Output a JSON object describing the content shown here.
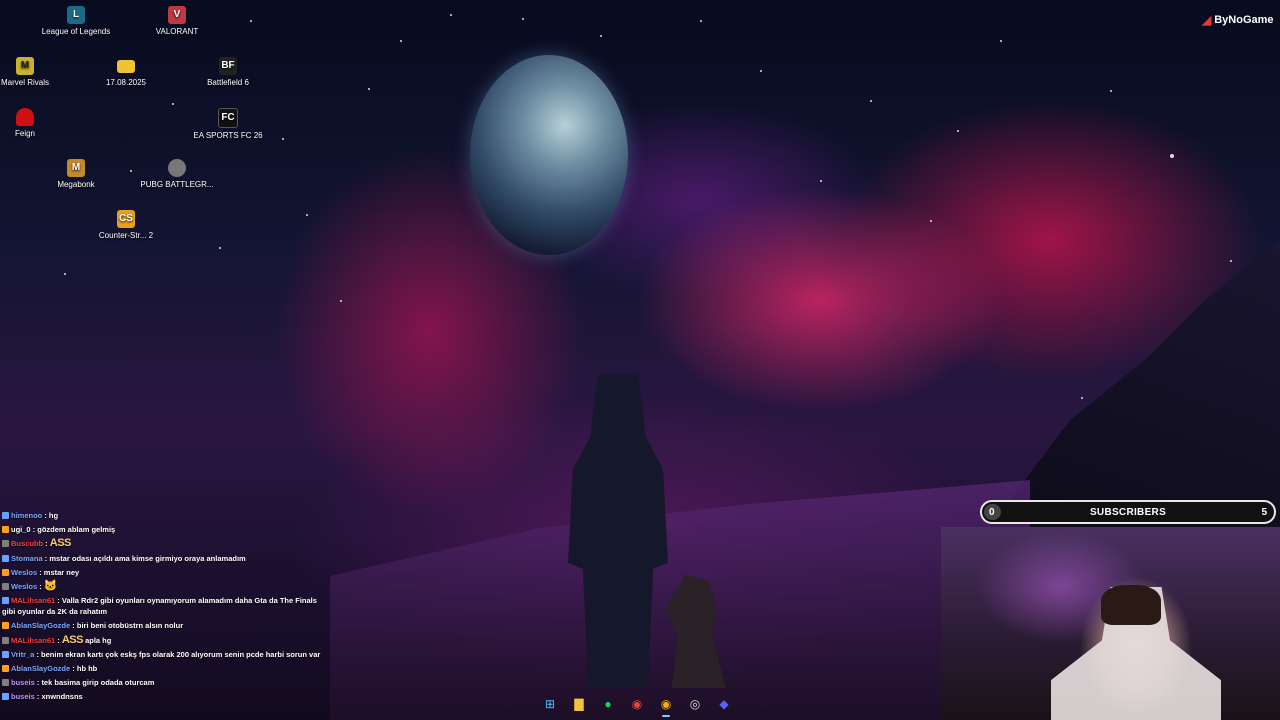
{
  "branding": {
    "label": "ByNoGame"
  },
  "desktop_icons": [
    {
      "label": "League of Legends",
      "icon": "league-of-legends-icon",
      "color": "#1a6b8a"
    },
    {
      "label": "VALORANT",
      "icon": "valorant-icon",
      "color": "#bd3944"
    },
    {
      "label": "Marvel Rivals",
      "icon": "marvel-rivals-icon",
      "color": "#c8b230"
    },
    {
      "label": "17.08.2025",
      "icon": "folder-icon",
      "color": "#f1c232"
    },
    {
      "label": "Battlefield 6",
      "icon": "battlefield-icon",
      "color": "#222"
    },
    {
      "label": "Feign",
      "icon": "feign-icon",
      "color": "#d01010"
    },
    {
      "label": "EA SPORTS FC 26",
      "icon": "ea-sports-fc-icon",
      "color": "#111"
    },
    {
      "label": "Megabonk",
      "icon": "megabonk-icon",
      "color": "#c48a2a"
    },
    {
      "label": "PUBG BATTLEGR...",
      "icon": "pubg-icon",
      "color": "#777"
    },
    {
      "label": "Counter-Str... 2",
      "icon": "counter-strike-icon",
      "color": "#e8a020"
    }
  ],
  "subscribers": {
    "label": "SUBSCRIBERS",
    "current": "0",
    "goal": "5",
    "progress": 0.06
  },
  "chat": [
    {
      "user": "himenoo",
      "color": "#7aa8ff",
      "text": "hg"
    },
    {
      "user": "ugi_0",
      "color": "#ffffff",
      "text": "gözdem ablam gelmiş"
    },
    {
      "user": "Buscubb",
      "color": "#ff3b3b",
      "text": "",
      "emote": "ASS"
    },
    {
      "user": "Stomana",
      "color": "#7aa8ff",
      "text": "mstar odası açıldı ama kimse girmiyo oraya anlamadım"
    },
    {
      "user": "Weslos",
      "color": "#7aa8ff",
      "text": "mstar ney"
    },
    {
      "user": "Weslos",
      "color": "#7aa8ff",
      "text": "",
      "emote": "🐱"
    },
    {
      "user": "MALihsan61",
      "color": "#ff3b3b",
      "text": "Valla Rdr2 gibi oyunları oynamıyorum alamadım daha Gta da The Finals gibi oyunlar da 2K da rahatım"
    },
    {
      "user": "AblanSlayGozde",
      "color": "#7aa8ff",
      "text": "biri beni otobüstrn alsın nolur"
    },
    {
      "user": "MALihsan61",
      "color": "#ff3b3b",
      "text": "apla hg",
      "emote": "ASS"
    },
    {
      "user": "Vritr_a",
      "color": "#7aa8ff",
      "text": "benim ekran kartı çok eskş fps olarak 200 alıyorum senin pcde harbi sorun var"
    },
    {
      "user": "AblanSlayGozde",
      "color": "#7aa8ff",
      "text": "hb hb"
    },
    {
      "user": "buseis",
      "color": "#c990ff",
      "text": "tek basima girip odada oturcam"
    },
    {
      "user": "buseis",
      "color": "#c990ff",
      "text": "xnwndnsns"
    }
  ],
  "taskbar": [
    {
      "name": "start-icon",
      "glyph": "⊞",
      "color": "#4cc2ff"
    },
    {
      "name": "file-explorer-icon",
      "glyph": "▇",
      "color": "#f3c33b"
    },
    {
      "name": "spotify-icon",
      "glyph": "●",
      "color": "#1ed760"
    },
    {
      "name": "chrome-icon",
      "glyph": "◉",
      "color": "#e8453c"
    },
    {
      "name": "chrome-profile-icon",
      "glyph": "◉",
      "color": "#f4b400"
    },
    {
      "name": "obs-icon",
      "glyph": "◎",
      "color": "#dddddd"
    },
    {
      "name": "discord-icon",
      "glyph": "◆",
      "color": "#5865f2"
    }
  ]
}
